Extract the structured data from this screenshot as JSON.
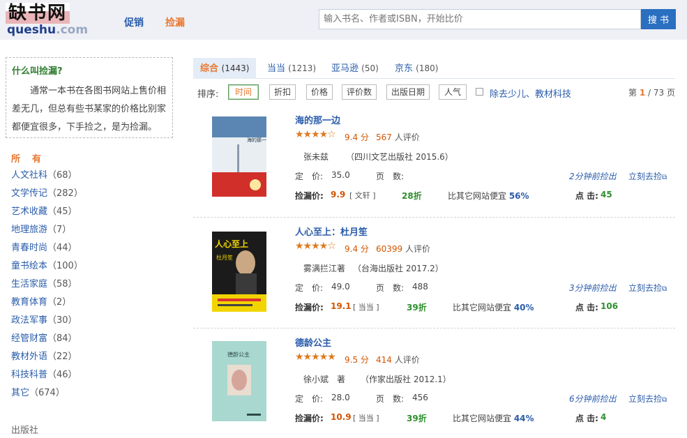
{
  "header": {
    "logo_cn": "缺书网",
    "logo_en_main": "queshu",
    "logo_en_tld": ".com",
    "nav": [
      {
        "label": "促销"
      },
      {
        "label": "捡漏"
      }
    ],
    "search_placeholder": "输入书名、作者或ISBN，开始比价",
    "search_button": "搜 书"
  },
  "sidebar": {
    "info_title": "什么叫捡漏?",
    "info_text": "通常一本书在各图书网站上售价相差无几，但总有些书某家的价格比别家都便宜很多，下手捡之，是为捡漏。",
    "all_label": "所　有",
    "categories": [
      {
        "name": "人文社科",
        "count": "（68）"
      },
      {
        "name": "文学传记",
        "count": "（282）"
      },
      {
        "name": "艺术收藏",
        "count": "（45）"
      },
      {
        "name": "地理旅游",
        "count": "（7）"
      },
      {
        "name": "青春时尚",
        "count": "（44）"
      },
      {
        "name": "童书绘本",
        "count": "（100）"
      },
      {
        "name": "生活家庭",
        "count": "（58）"
      },
      {
        "name": "教育体育",
        "count": "（2）"
      },
      {
        "name": "政法军事",
        "count": "（30）"
      },
      {
        "name": "经管财富",
        "count": "（84）"
      },
      {
        "name": "教材外语",
        "count": "（22）"
      },
      {
        "name": "科技科普",
        "count": "（46）"
      },
      {
        "name": "其它",
        "count": "（674）"
      }
    ],
    "publisher_heading": "出版社"
  },
  "tabs": [
    {
      "label": "综合",
      "count": "(1443)"
    },
    {
      "label": "当当",
      "count": "(1213)"
    },
    {
      "label": "亚马逊",
      "count": "(50)"
    },
    {
      "label": "京东",
      "count": "(180)"
    }
  ],
  "sortbar": {
    "label": "排序:",
    "buttons": [
      "时间",
      "折扣",
      "价格",
      "评价数",
      "出版日期",
      "人气"
    ],
    "filter_label": "除去少儿、教材科技",
    "page_prefix": "第",
    "page_current": "1",
    "page_suffix": "/ 73 页"
  },
  "books": [
    {
      "title": "海的那一边",
      "stars": "★★★★☆",
      "score": "9.4 分",
      "reviews_num": "567",
      "reviews_suffix": " 人评价",
      "author": "张未兹",
      "publisher": "（四川文艺出版社 2015.6）",
      "price_label": "定　价:",
      "price": "35.0",
      "pages_label": "页　数:",
      "pages": "",
      "found": "2分钟前捡出",
      "go": "立刻去捡",
      "leak_label": "捡漏价:",
      "leak_price": "9.9",
      "store": "[ 文轩 ]",
      "discount": "28折",
      "cheaper_prefix": "比其它网站便宜 ",
      "cheaper_pct": "56%",
      "clicks_label": "点 击:",
      "clicks": "45",
      "cover_title": "海的那一边",
      "cover_colors": [
        "#5b86b3",
        "#ffffff",
        "#d12f2a"
      ]
    },
    {
      "title": "人心至上：杜月笙",
      "stars": "★★★★☆",
      "score": "9.4 分",
      "reviews_num": "60399",
      "reviews_suffix": " 人评价",
      "author": "雾满拦江著",
      "publisher": "（台海出版社 2017.2）",
      "price_label": "定　价:",
      "price": "49.0",
      "pages_label": "页　数:",
      "pages": "488",
      "found": "3分钟前捡出",
      "go": "立刻去捡",
      "leak_label": "捡漏价:",
      "leak_price": "19.1",
      "store": "[ 当当 ]",
      "discount": "39折",
      "cheaper_prefix": "比其它网站便宜 ",
      "cheaper_pct": "40%",
      "clicks_label": "点 击:",
      "clicks": "106",
      "cover_title": "人心至上",
      "cover_subtitle": "杜月笙",
      "cover_colors": [
        "#f2d500",
        "#1b1b1b"
      ]
    },
    {
      "title": "德龄公主",
      "stars": "★★★★★",
      "score": "9.5 分",
      "reviews_num": "414",
      "reviews_suffix": " 人评价",
      "author": "徐小斌　著",
      "publisher": "（作家出版社 2012.1）",
      "price_label": "定　价:",
      "price": "28.0",
      "pages_label": "页　数:",
      "pages": "456",
      "found": "6分钟前捡出",
      "go": "立刻去捡",
      "leak_label": "捡漏价:",
      "leak_price": "10.9",
      "store": "[ 当当 ]",
      "discount": "39折",
      "cheaper_prefix": "比其它网站便宜 ",
      "cheaper_pct": "44%",
      "clicks_label": "点 击:",
      "clicks": "4",
      "cover_title": "德龄公主",
      "cover_colors": [
        "#a8d8cf",
        "#d6a59a"
      ]
    }
  ]
}
